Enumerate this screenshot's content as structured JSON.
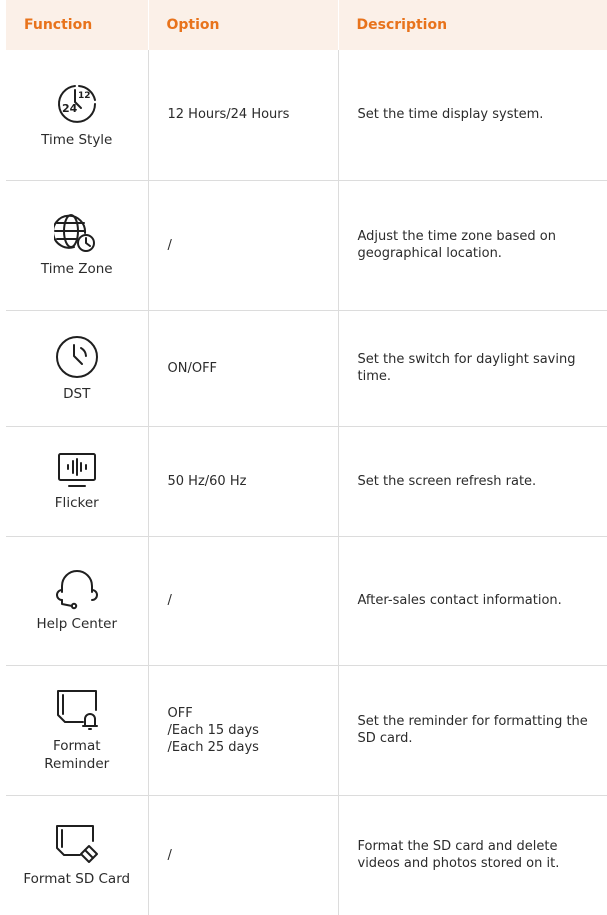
{
  "header": {
    "function": "Function",
    "option": "Option",
    "description": "Description"
  },
  "rows": [
    {
      "function": "Time Style",
      "icon": "clock-12-24-icon",
      "option": "12 Hours/24 Hours",
      "description": "Set the time display system."
    },
    {
      "function": "Time Zone",
      "icon": "globe-clock-icon",
      "option": "/",
      "description": "Adjust the time zone based on geographical location."
    },
    {
      "function": "DST",
      "icon": "clock-icon",
      "option": "ON/OFF",
      "description": "Set the switch for daylight saving time."
    },
    {
      "function": "Flicker",
      "icon": "monitor-waveform-icon",
      "option": "50 Hz/60 Hz",
      "description": "Set the screen refresh rate."
    },
    {
      "function": "Help Center",
      "icon": "headset-icon",
      "option": "/",
      "description": "After-sales contact information."
    },
    {
      "function": "Format Reminder",
      "icon": "sd-card-bell-icon",
      "option_lines": [
        "OFF",
        "/Each 15 days",
        "/Each 25 days"
      ],
      "description": "Set the reminder for formatting the SD card."
    },
    {
      "function": "Format SD Card",
      "icon": "sd-card-eraser-icon",
      "option": "/",
      "description": "Format the SD card and delete videos and photos stored on it."
    }
  ],
  "colors": {
    "header_bg": "#fbf0e8",
    "header_text": "#e8731c",
    "border": "#dcdcdc"
  }
}
